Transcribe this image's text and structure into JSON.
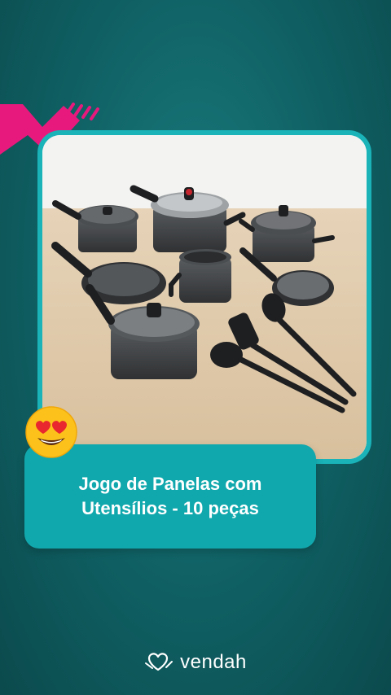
{
  "product": {
    "title_line1": "Jogo de Panelas com",
    "title_line2": "Utensílios - 10 peças",
    "image_alt": "cookware set photo"
  },
  "brand": {
    "name": "vendah",
    "logo_icon": "heart-hands-icon"
  },
  "decor": {
    "emoji": "heart-eyes-emoji",
    "accent_shape": "pink-zigzag-shape"
  },
  "colors": {
    "background": "#0f5f62",
    "frame": "#19b3b8",
    "card": "#11a8ad",
    "accent": "#e8197d",
    "text": "#ffffff"
  }
}
